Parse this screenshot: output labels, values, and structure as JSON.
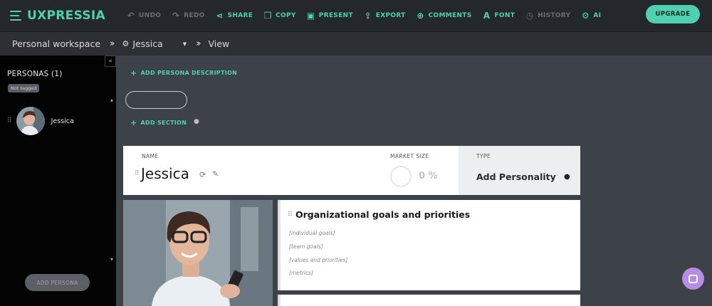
{
  "app": {
    "logo_text": "UXPRESSIA",
    "brand_color": "#4fd1b0"
  },
  "toolbar": {
    "items": [
      {
        "label": "UNDO",
        "icon": "undo-icon",
        "enabled": false
      },
      {
        "label": "REDO",
        "icon": "redo-icon",
        "enabled": false
      },
      {
        "label": "SHARE",
        "icon": "share-icon",
        "enabled": true
      },
      {
        "label": "COPY",
        "icon": "copy-icon",
        "enabled": true
      },
      {
        "label": "PRESENT",
        "icon": "present-icon",
        "enabled": true
      },
      {
        "label": "EXPORT",
        "icon": "export-icon",
        "enabled": true
      },
      {
        "label": "COMMENTS",
        "icon": "comments-icon",
        "enabled": true
      },
      {
        "label": "FONT",
        "icon": "font-icon",
        "enabled": true
      },
      {
        "label": "HISTORY",
        "icon": "history-icon",
        "enabled": false
      },
      {
        "label": "AI",
        "icon": "ai-chip-icon",
        "enabled": true
      }
    ],
    "upgrade_label": "UPGRADE"
  },
  "breadcrumb": {
    "workspace": "Personal workspace",
    "persona": "Jessica",
    "mode": "View"
  },
  "sidebar": {
    "title": "PERSONAS (1)",
    "tag": "Not tagged",
    "personas": [
      {
        "name": "Jessica"
      }
    ],
    "add_button": "ADD PERSONA"
  },
  "main": {
    "add_description": "ADD PERSONA DESCRIPTION",
    "add_section": "ADD SECTION",
    "header": {
      "name_label": "NAME",
      "name_value": "Jessica",
      "market_size_label": "MARKET SIZE",
      "market_size_value": "0 %",
      "type_label": "TYPE",
      "type_value": "Add Personality"
    },
    "section": {
      "title": "Organizational goals and priorities",
      "items": [
        "[individual goals]",
        "[team goals]",
        "[values and priorities]",
        "[metrics]"
      ]
    }
  }
}
